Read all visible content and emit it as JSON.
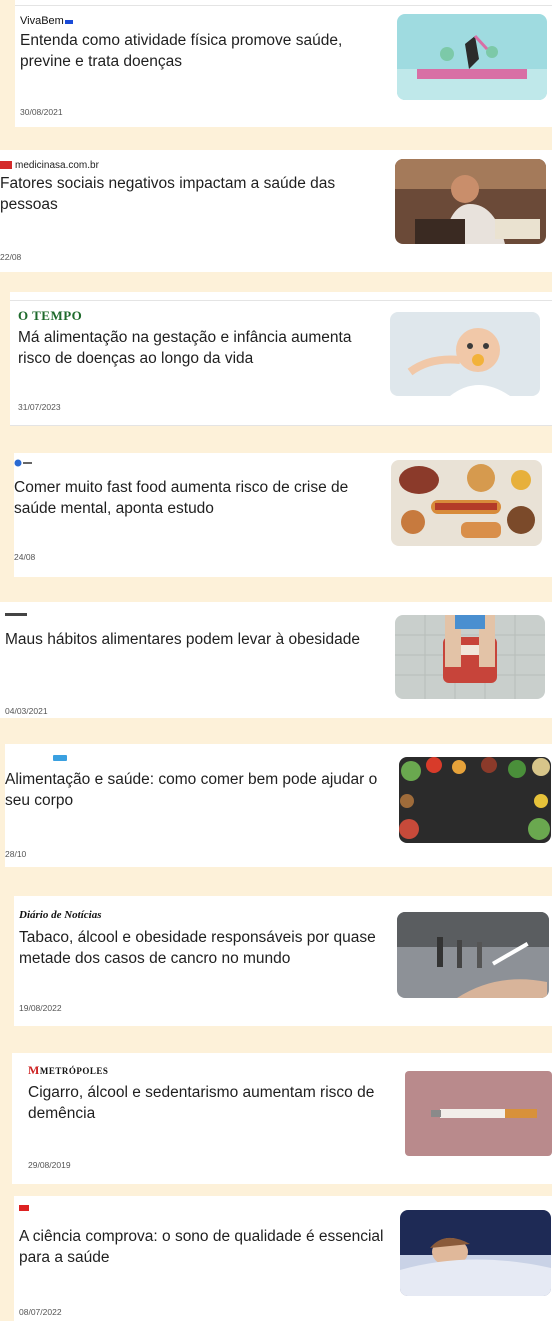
{
  "articles": [
    {
      "source": "VivaBem",
      "headline": "Entenda como atividade física promove saúde, previne e trata doenças",
      "date": "30/08/2021"
    },
    {
      "source": "medicinasa.com.br",
      "headline": "Fatores sociais negativos impactam a saúde das pessoas",
      "date": "22/08"
    },
    {
      "source": "O TEMPO",
      "headline": "Má alimentação na gestação e infância aumenta risco de doenças ao longo da vida",
      "date": "31/07/2023"
    },
    {
      "source": "",
      "headline": "Comer muito fast food aumenta risco de crise de saúde mental, aponta estudo",
      "date": "24/08"
    },
    {
      "source": "",
      "headline": "Maus hábitos alimentares podem levar à obesidade",
      "date": "04/03/2021"
    },
    {
      "source": "",
      "headline": "Alimentação e saúde: como comer bem pode ajudar o seu corpo",
      "date": "28/10"
    },
    {
      "source": "Diário de Notícias",
      "headline": "Tabaco, álcool e obesidade responsáveis por quase metade dos casos de cancro no mundo",
      "date": "19/08/2022"
    },
    {
      "source": "METRÓPOLES",
      "headline": "Cigarro, álcool e sedentarismo aumentam risco de demência",
      "date": "29/08/2019"
    },
    {
      "source": "",
      "headline": "A ciência comprova: o sono de qualidade é essencial para a saúde",
      "date": "08/07/2022"
    }
  ]
}
